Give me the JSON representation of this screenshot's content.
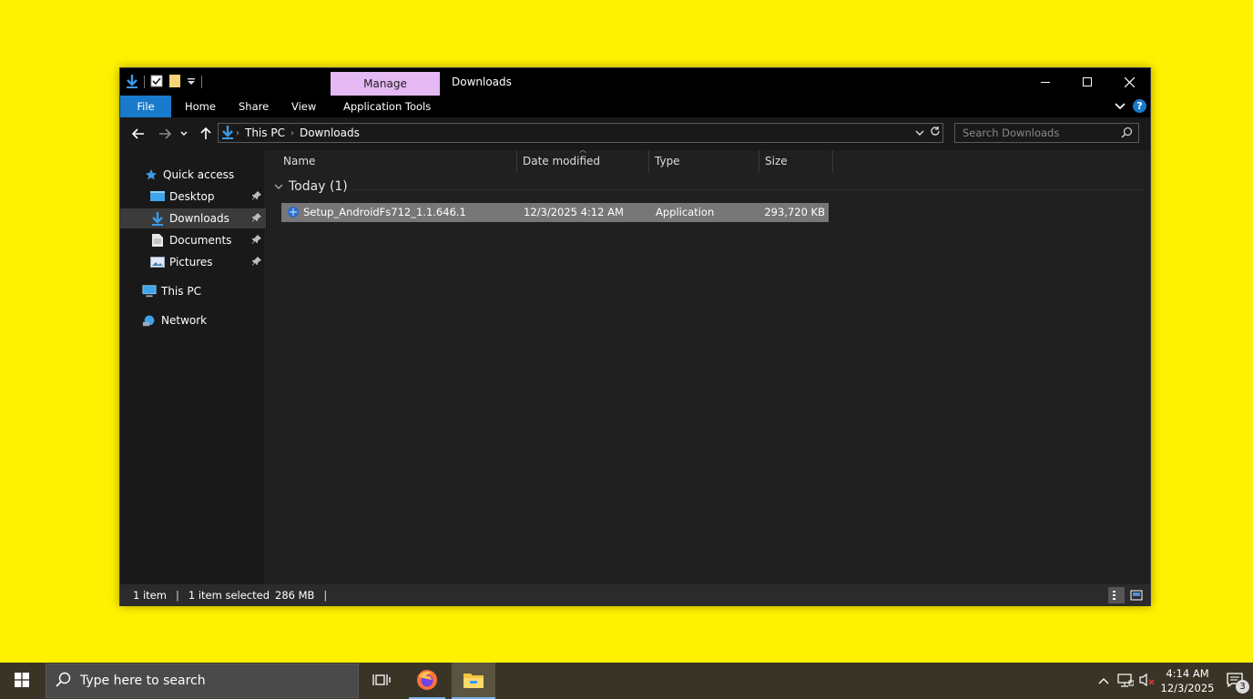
{
  "window": {
    "title": "Downloads",
    "manage_tab": "Manage",
    "ribbon_tabs": {
      "file": "File",
      "home": "Home",
      "share": "Share",
      "view": "View",
      "app_tools": "Application Tools"
    },
    "help": "?"
  },
  "address": {
    "crumbs": [
      "This PC",
      "Downloads"
    ],
    "search_placeholder": "Search Downloads"
  },
  "navpane": {
    "quick_access": "Quick access",
    "desktop": "Desktop",
    "downloads": "Downloads",
    "documents": "Documents",
    "pictures": "Pictures",
    "this_pc": "This PC",
    "network": "Network"
  },
  "columns": {
    "name": "Name",
    "date": "Date modified",
    "type": "Type",
    "size": "Size"
  },
  "group": {
    "label": "Today (1)"
  },
  "files": [
    {
      "name": "Setup_AndroidFs712_1.1.646.1",
      "date": "12/3/2025 4:12 AM",
      "type": "Application",
      "size": "293,720 KB"
    }
  ],
  "status": {
    "count": "1 item",
    "selected": "1 item selected",
    "size": "286 MB",
    "bar": "|"
  },
  "taskbar": {
    "search_placeholder": "Type here to search",
    "time": "4:14 AM",
    "date": "12/3/2025",
    "notifications": "3"
  },
  "colors": {
    "accent": "#1979ca",
    "manage": "#e4b8f2",
    "desktop_bg": "#fff200"
  }
}
